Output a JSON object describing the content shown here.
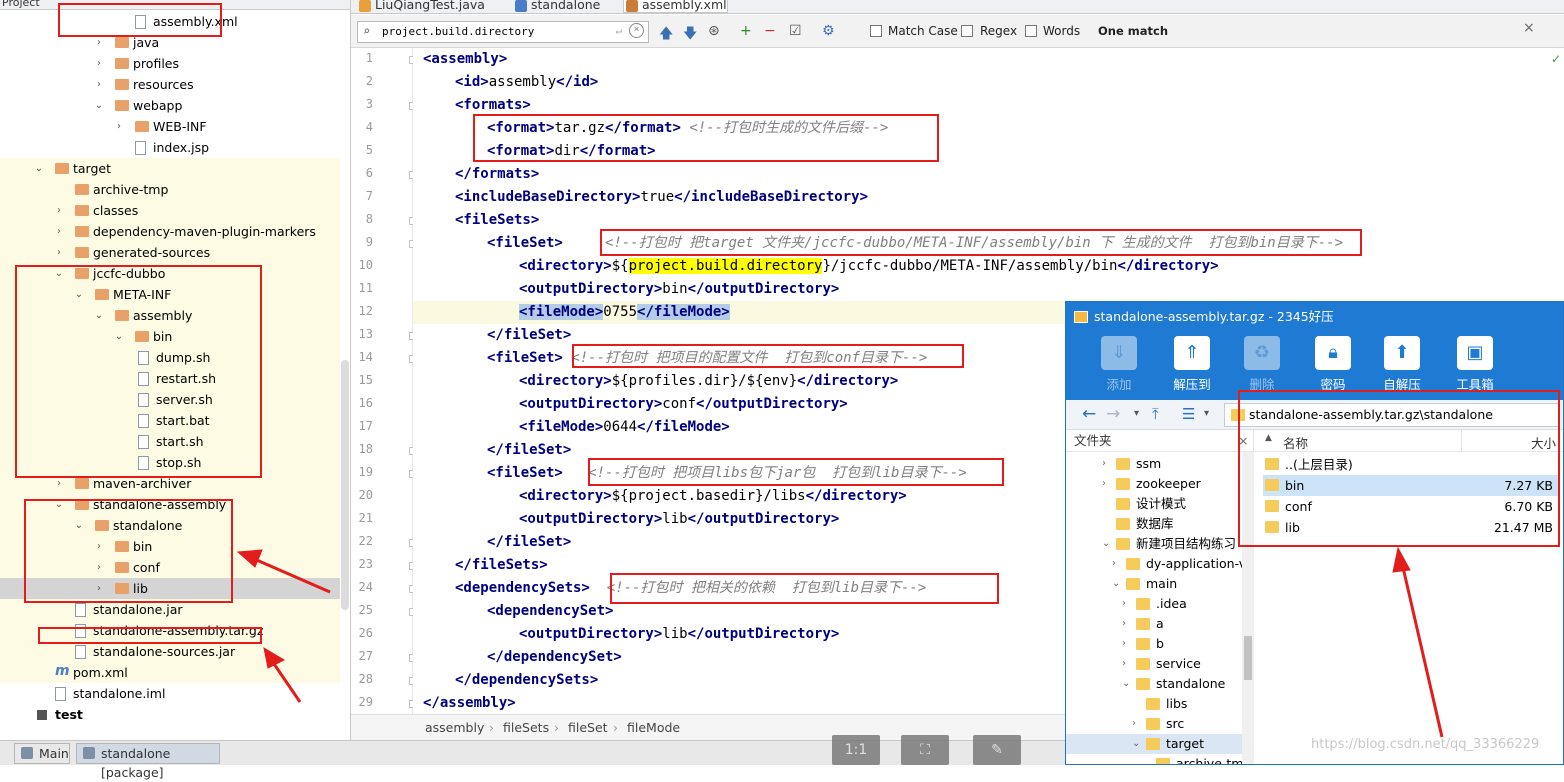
{
  "project_panel": {
    "header_label": "Project",
    "tree": [
      {
        "label": "assembly.xml",
        "depth": 5,
        "icon": "xml-file-icon",
        "arrow": ""
      },
      {
        "label": "java",
        "depth": 4,
        "icon": "folder-icon",
        "arrow": "›"
      },
      {
        "label": "profiles",
        "depth": 4,
        "icon": "folder-icon",
        "arrow": "›"
      },
      {
        "label": "resources",
        "depth": 4,
        "icon": "folder-icon",
        "arrow": "›"
      },
      {
        "label": "webapp",
        "depth": 4,
        "icon": "folder-icon",
        "arrow": "⌄"
      },
      {
        "label": "WEB-INF",
        "depth": 5,
        "icon": "folder-icon",
        "arrow": "›"
      },
      {
        "label": "index.jsp",
        "depth": 5,
        "icon": "jsp-file-icon",
        "arrow": ""
      },
      {
        "label": "target",
        "depth": 1,
        "icon": "folder-icon",
        "arrow": "⌄"
      },
      {
        "label": "archive-tmp",
        "depth": 2,
        "icon": "folder-icon",
        "arrow": ""
      },
      {
        "label": "classes",
        "depth": 2,
        "icon": "folder-icon",
        "arrow": "›"
      },
      {
        "label": "dependency-maven-plugin-markers",
        "depth": 2,
        "icon": "folder-icon",
        "arrow": "›"
      },
      {
        "label": "generated-sources",
        "depth": 2,
        "icon": "folder-icon",
        "arrow": "›"
      },
      {
        "label": "jccfc-dubbo",
        "depth": 2,
        "icon": "folder-icon",
        "arrow": "⌄"
      },
      {
        "label": "META-INF",
        "depth": 3,
        "icon": "folder-icon",
        "arrow": "⌄"
      },
      {
        "label": "assembly",
        "depth": 4,
        "icon": "folder-icon",
        "arrow": "⌄"
      },
      {
        "label": "bin",
        "depth": 5,
        "icon": "folder-icon",
        "arrow": "⌄"
      },
      {
        "label": "dump.sh",
        "depth": 7,
        "icon": "file-icon",
        "arrow": ""
      },
      {
        "label": "restart.sh",
        "depth": 7,
        "icon": "file-icon",
        "arrow": ""
      },
      {
        "label": "server.sh",
        "depth": 7,
        "icon": "file-icon",
        "arrow": ""
      },
      {
        "label": "start.bat",
        "depth": 7,
        "icon": "file-icon",
        "arrow": ""
      },
      {
        "label": "start.sh",
        "depth": 7,
        "icon": "file-icon",
        "arrow": ""
      },
      {
        "label": "stop.sh",
        "depth": 7,
        "icon": "file-icon",
        "arrow": ""
      },
      {
        "label": "maven-archiver",
        "depth": 2,
        "icon": "folder-icon",
        "arrow": "›"
      },
      {
        "label": "standalone-assembly",
        "depth": 2,
        "icon": "folder-icon",
        "arrow": "⌄"
      },
      {
        "label": "standalone",
        "depth": 3,
        "icon": "folder-icon",
        "arrow": "⌄"
      },
      {
        "label": "bin",
        "depth": 4,
        "icon": "folder-icon",
        "arrow": "›"
      },
      {
        "label": "conf",
        "depth": 4,
        "icon": "folder-icon",
        "arrow": "›"
      },
      {
        "label": "lib",
        "depth": 4,
        "icon": "folder-icon",
        "arrow": "›"
      },
      {
        "label": "standalone.jar",
        "depth": 2,
        "icon": "jar-file-icon",
        "arrow": ""
      },
      {
        "label": "standalone-assembly.tar.gz",
        "depth": 2,
        "icon": "archive-file-icon",
        "arrow": ""
      },
      {
        "label": "standalone-sources.jar",
        "depth": 2,
        "icon": "jar-file-icon",
        "arrow": ""
      },
      {
        "label": "pom.xml",
        "depth": 1,
        "icon": "maven-icon",
        "arrow": ""
      },
      {
        "label": "standalone.iml",
        "depth": 1,
        "icon": "iml-file-icon",
        "arrow": ""
      },
      {
        "label": "test",
        "depth": 0,
        "icon": "module-icon",
        "arrow": ""
      }
    ]
  },
  "editor": {
    "tabs": [
      {
        "label": "LiuQiangTest.java",
        "icon_color": "#e8a03a"
      },
      {
        "label": "standalone",
        "icon_color": "#4a7cc9"
      },
      {
        "label": "assembly.xml",
        "icon_color": "#c97d3a"
      }
    ],
    "find": {
      "query": "project.build.directory",
      "match_case_label": "Match Case",
      "regex_label": "Regex",
      "words_label": "Words",
      "result_label": "One match"
    },
    "code_lines": [
      {
        "n": "1",
        "indent": 0,
        "parts": [
          [
            "tg",
            "<assembly"
          ],
          [
            "tg",
            ">"
          ]
        ]
      },
      {
        "n": "2",
        "indent": 1,
        "parts": [
          [
            "tg",
            "<id>"
          ],
          [
            "t",
            "assembly"
          ],
          [
            "tg",
            "</id>"
          ]
        ]
      },
      {
        "n": "3",
        "indent": 1,
        "parts": [
          [
            "tg",
            "<formats>"
          ]
        ]
      },
      {
        "n": "4",
        "indent": 2,
        "parts": [
          [
            "tg",
            "<format>"
          ],
          [
            "t",
            "tar.gz"
          ],
          [
            "tg",
            "</format>"
          ],
          [
            "t",
            " "
          ],
          [
            "cm",
            "<!--打包时生成的文件后缀-->"
          ]
        ]
      },
      {
        "n": "5",
        "indent": 2,
        "parts": [
          [
            "tg",
            "<format>"
          ],
          [
            "t",
            "dir"
          ],
          [
            "tg",
            "</format>"
          ]
        ]
      },
      {
        "n": "6",
        "indent": 1,
        "parts": [
          [
            "tg",
            "</formats>"
          ]
        ]
      },
      {
        "n": "7",
        "indent": 1,
        "parts": [
          [
            "tg",
            "<includeBaseDirectory>"
          ],
          [
            "t",
            "true"
          ],
          [
            "tg",
            "</includeBaseDirectory>"
          ]
        ]
      },
      {
        "n": "8",
        "indent": 1,
        "parts": [
          [
            "tg",
            "<fileSets>"
          ]
        ]
      },
      {
        "n": "9",
        "indent": 2,
        "parts": [
          [
            "tg",
            "<fileSet>"
          ],
          [
            "t",
            "     "
          ],
          [
            "cm",
            "<!--打包时 把target 文件夹/jccfc-dubbo/META-INF/assembly/bin 下 生成的文件  打包到bin目录下-->"
          ]
        ]
      },
      {
        "n": "10",
        "indent": 3,
        "parts": [
          [
            "tg",
            "<directory>"
          ],
          [
            "t",
            "${"
          ],
          [
            "hlw",
            "project.build.directory"
          ],
          [
            "t",
            "}/jccfc-dubbo/META-INF/assembly/bin"
          ],
          [
            "tg",
            "</directory>"
          ]
        ]
      },
      {
        "n": "11",
        "indent": 3,
        "parts": [
          [
            "tg",
            "<outputDirectory>"
          ],
          [
            "t",
            "bin"
          ],
          [
            "tg",
            "</outputDirectory>"
          ]
        ]
      },
      {
        "n": "12",
        "indent": 3,
        "parts": [
          [
            "hlb",
            "<fileMode>"
          ],
          [
            "t",
            "0755"
          ],
          [
            "hlb",
            "</fileMode>"
          ]
        ]
      },
      {
        "n": "13",
        "indent": 2,
        "parts": [
          [
            "tg",
            "</fileSet>"
          ]
        ]
      },
      {
        "n": "14",
        "indent": 2,
        "parts": [
          [
            "tg",
            "<fileSet>"
          ],
          [
            "t",
            " "
          ],
          [
            "cm",
            "<!--打包时 把项目的配置文件  打包到conf目录下-->"
          ]
        ]
      },
      {
        "n": "15",
        "indent": 3,
        "parts": [
          [
            "tg",
            "<directory>"
          ],
          [
            "t",
            "${profiles.dir}/${env}"
          ],
          [
            "tg",
            "</directory>"
          ]
        ]
      },
      {
        "n": "16",
        "indent": 3,
        "parts": [
          [
            "tg",
            "<outputDirectory>"
          ],
          [
            "t",
            "conf"
          ],
          [
            "tg",
            "</outputDirectory>"
          ]
        ]
      },
      {
        "n": "17",
        "indent": 3,
        "parts": [
          [
            "tg",
            "<fileMode>"
          ],
          [
            "t",
            "0644"
          ],
          [
            "tg",
            "</fileMode>"
          ]
        ]
      },
      {
        "n": "18",
        "indent": 2,
        "parts": [
          [
            "tg",
            "</fileSet>"
          ]
        ]
      },
      {
        "n": "19",
        "indent": 2,
        "parts": [
          [
            "tg",
            "<fileSet>"
          ],
          [
            "t",
            "   "
          ],
          [
            "cm",
            "<!--打包时 把项目libs包下jar包  打包到lib目录下-->"
          ]
        ]
      },
      {
        "n": "20",
        "indent": 3,
        "parts": [
          [
            "tg",
            "<directory>"
          ],
          [
            "t",
            "${project.basedir}/libs"
          ],
          [
            "tg",
            "</directory>"
          ]
        ]
      },
      {
        "n": "21",
        "indent": 3,
        "parts": [
          [
            "tg",
            "<outputDirectory>"
          ],
          [
            "t",
            "lib"
          ],
          [
            "tg",
            "</outputDirectory>"
          ]
        ]
      },
      {
        "n": "22",
        "indent": 2,
        "parts": [
          [
            "tg",
            "</fileSet>"
          ]
        ]
      },
      {
        "n": "23",
        "indent": 1,
        "parts": [
          [
            "tg",
            "</fileSets>"
          ]
        ]
      },
      {
        "n": "24",
        "indent": 1,
        "parts": [
          [
            "tg",
            "<dependencySets>"
          ],
          [
            "t",
            "  "
          ],
          [
            "cm",
            "<!--打包时 把相关的依赖  打包到lib目录下-->"
          ]
        ]
      },
      {
        "n": "25",
        "indent": 2,
        "parts": [
          [
            "tg",
            "<dependencySet>"
          ]
        ]
      },
      {
        "n": "26",
        "indent": 3,
        "parts": [
          [
            "tg",
            "<outputDirectory>"
          ],
          [
            "t",
            "lib"
          ],
          [
            "tg",
            "</outputDirectory>"
          ]
        ]
      },
      {
        "n": "27",
        "indent": 2,
        "parts": [
          [
            "tg",
            "</dependencySet>"
          ]
        ]
      },
      {
        "n": "28",
        "indent": 1,
        "parts": [
          [
            "tg",
            "</dependencySets>"
          ]
        ]
      },
      {
        "n": "29",
        "indent": 0,
        "parts": [
          [
            "tg",
            "</assembly>"
          ]
        ]
      }
    ],
    "breadcrumb": [
      "assembly",
      "fileSets",
      "fileSet",
      "fileMode"
    ]
  },
  "bottom_bar": {
    "tabs": [
      "Main",
      "standalone [package]"
    ]
  },
  "archive_window": {
    "title": "standalone-assembly.tar.gz - 2345好压",
    "toolbar": [
      {
        "label": "添加",
        "icon": "add-icon",
        "enabled": false
      },
      {
        "label": "解压到",
        "icon": "extract-icon",
        "enabled": true
      },
      {
        "label": "删除",
        "icon": "delete-icon",
        "enabled": false
      },
      {
        "label": "密码",
        "icon": "lock-icon",
        "enabled": true
      },
      {
        "label": "自解压",
        "icon": "self-extract-icon",
        "enabled": true
      },
      {
        "label": "工具箱",
        "icon": "toolbox-icon",
        "enabled": true
      }
    ],
    "address": "standalone-assembly.tar.gz\\standalone",
    "left_header": "文件夹",
    "left_tree": [
      {
        "label": "ssm",
        "indent": 0,
        "arrow": "›"
      },
      {
        "label": "zookeeper",
        "indent": 0,
        "arrow": "›"
      },
      {
        "label": "设计模式",
        "indent": 0,
        "arrow": ""
      },
      {
        "label": "数据库",
        "indent": 0,
        "arrow": ""
      },
      {
        "label": "新建项目结构练习",
        "indent": 0,
        "arrow": "⌄"
      },
      {
        "label": "dy-application-v",
        "indent": 1,
        "arrow": "›"
      },
      {
        "label": "main",
        "indent": 1,
        "arrow": "⌄"
      },
      {
        "label": ".idea",
        "indent": 2,
        "arrow": "›"
      },
      {
        "label": "a",
        "indent": 2,
        "arrow": "›"
      },
      {
        "label": "b",
        "indent": 2,
        "arrow": "›"
      },
      {
        "label": "service",
        "indent": 2,
        "arrow": "›"
      },
      {
        "label": "standalone",
        "indent": 2,
        "arrow": "⌄"
      },
      {
        "label": "libs",
        "indent": 3,
        "arrow": ""
      },
      {
        "label": "src",
        "indent": 3,
        "arrow": "›"
      },
      {
        "label": "target",
        "indent": 3,
        "arrow": "⌄"
      },
      {
        "label": "archive-tmp",
        "indent": 4,
        "arrow": ""
      }
    ],
    "columns": {
      "name": "名称",
      "size": "大小"
    },
    "files": [
      {
        "name": "..(上层目录)",
        "size": ""
      },
      {
        "name": "bin",
        "size": "7.27 KB"
      },
      {
        "name": "conf",
        "size": "6.70 KB"
      },
      {
        "name": "lib",
        "size": "21.47 MB"
      }
    ]
  },
  "watermark": "https://blog.csdn.net/qq_33366229",
  "colors": {
    "annotation_red": "#e31c1c",
    "tag_blue": "#000080",
    "archive_blue": "#1e7ad2"
  }
}
